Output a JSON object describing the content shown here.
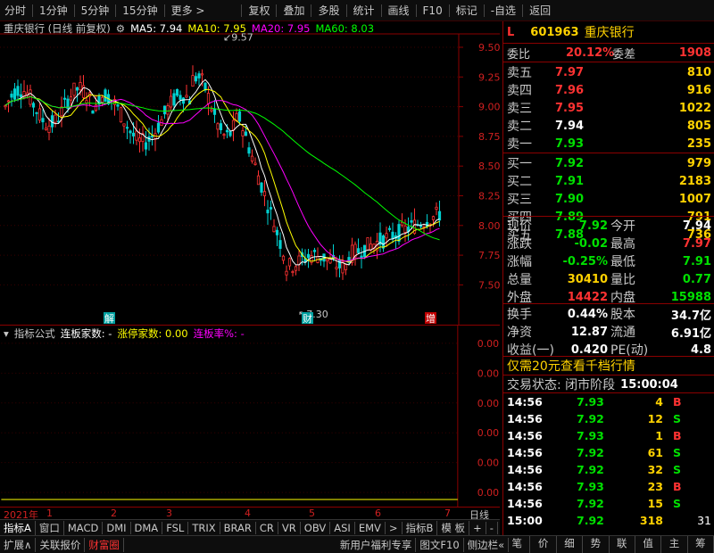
{
  "toolbar": {
    "items": [
      "分时",
      "1分钟",
      "5分钟",
      "15分钟",
      "更多 >",
      "复权",
      "叠加",
      "多股",
      "统计",
      "画线",
      "F10",
      "标记",
      "-自选",
      "返回"
    ]
  },
  "chart_info": {
    "stock": "重庆银行 (日线 前复权)",
    "ma5": "MA5: 7.94",
    "ma10": "MA10: 7.95",
    "ma20": "MA20: 7.95",
    "ma60": "MA60: 8.03"
  },
  "price_axis": [
    "9.50",
    "9.25",
    "9.00",
    "8.75",
    "8.50",
    "8.25",
    "8.00",
    "7.75",
    "7.50"
  ],
  "annotations": {
    "high": "9.57",
    "low": "7.30",
    "mark1": "解",
    "mark2": "财",
    "mark3": "增"
  },
  "indicator": {
    "name": "指标公式",
    "series1": "连板家数: -",
    "series2": "涨停家数: 0.00",
    "series3": "连板率%: -",
    "axis": [
      "0.00",
      "0.00",
      "0.00",
      "0.00",
      "0.00",
      "0.00"
    ]
  },
  "date_axis": {
    "year": "2021年",
    "months": [
      "1",
      "2",
      "3",
      "4",
      "5",
      "6",
      "7"
    ],
    "period": "日线"
  },
  "tabs": [
    "指标A",
    "窗口",
    "MACD",
    "DMI",
    "DMA",
    "FSL",
    "TRIX",
    "BRAR",
    "CR",
    "VR",
    "OBV",
    "ASI",
    "EMV",
    ">",
    "指标B",
    "模 板",
    "+",
    "-"
  ],
  "status": [
    "扩展∧",
    "关联报价",
    "财富圈",
    "新用户福利专享",
    "图文F10",
    "侧边栏«"
  ],
  "side_tabs": [
    "笔",
    "价",
    "细",
    "势",
    "联",
    "值",
    "主",
    "筹"
  ],
  "quote": {
    "level": "L",
    "code": "601963",
    "name": "重庆银行",
    "weibi_label": "委比",
    "weibi": "20.12%",
    "weicha_label": "委差",
    "weicha": "1908",
    "asks": [
      {
        "label": "卖五",
        "price": "7.97",
        "vol": "810"
      },
      {
        "label": "卖四",
        "price": "7.96",
        "vol": "916"
      },
      {
        "label": "卖三",
        "price": "7.95",
        "vol": "1022"
      },
      {
        "label": "卖二",
        "price": "7.94",
        "vol": "805"
      },
      {
        "label": "卖一",
        "price": "7.93",
        "vol": "235"
      }
    ],
    "bids": [
      {
        "label": "买一",
        "price": "7.92",
        "vol": "979"
      },
      {
        "label": "买二",
        "price": "7.91",
        "vol": "2183"
      },
      {
        "label": "买三",
        "price": "7.90",
        "vol": "1007"
      },
      {
        "label": "买四",
        "price": "7.89",
        "vol": "791"
      },
      {
        "label": "买五",
        "price": "7.88",
        "vol": "736"
      }
    ],
    "stats": [
      {
        "l1": "现价",
        "v1": "7.92",
        "l2": "今开",
        "v2": "7.94"
      },
      {
        "l1": "涨跌",
        "v1": "-0.02",
        "l2": "最高",
        "v2": "7.97"
      },
      {
        "l1": "涨幅",
        "v1": "-0.25%",
        "l2": "最低",
        "v2": "7.91"
      },
      {
        "l1": "总量",
        "v1": "30410",
        "l2": "量比",
        "v2": "0.77"
      },
      {
        "l1": "外盘",
        "v1": "14422",
        "l2": "内盘",
        "v2": "15988"
      }
    ],
    "stats2": [
      {
        "l1": "换手",
        "v1": "0.44%",
        "l2": "股本",
        "v2": "34.7亿"
      },
      {
        "l1": "净资",
        "v1": "12.87",
        "l2": "流通",
        "v2": "6.91亿"
      },
      {
        "l1": "收益(一)",
        "v1": "0.420",
        "l2": "PE(动)",
        "v2": "4.8"
      }
    ],
    "promo": "仅需20元查看千档行情",
    "trade_status_label": "交易状态: 闭市阶段",
    "trade_status_time": "15:00:04",
    "ticks": [
      {
        "t": "14:56",
        "p": "7.93",
        "v": "4",
        "d": "B"
      },
      {
        "t": "14:56",
        "p": "7.92",
        "v": "12",
        "d": "S"
      },
      {
        "t": "14:56",
        "p": "7.93",
        "v": "1",
        "d": "B"
      },
      {
        "t": "14:56",
        "p": "7.92",
        "v": "61",
        "d": "S"
      },
      {
        "t": "14:56",
        "p": "7.92",
        "v": "32",
        "d": "S"
      },
      {
        "t": "14:56",
        "p": "7.93",
        "v": "23",
        "d": "B"
      },
      {
        "t": "14:56",
        "p": "7.92",
        "v": "15",
        "d": "S"
      },
      {
        "t": "15:00",
        "p": "7.92",
        "v": "318",
        "d": "",
        "n": "31"
      }
    ]
  },
  "colors": {
    "up": "#ff3232",
    "down": "#00e000",
    "ma5": "#ffffff",
    "ma10": "#ffff00",
    "ma20": "#ff00ff",
    "ma60": "#00ff00",
    "frame": "#8b0000"
  }
}
